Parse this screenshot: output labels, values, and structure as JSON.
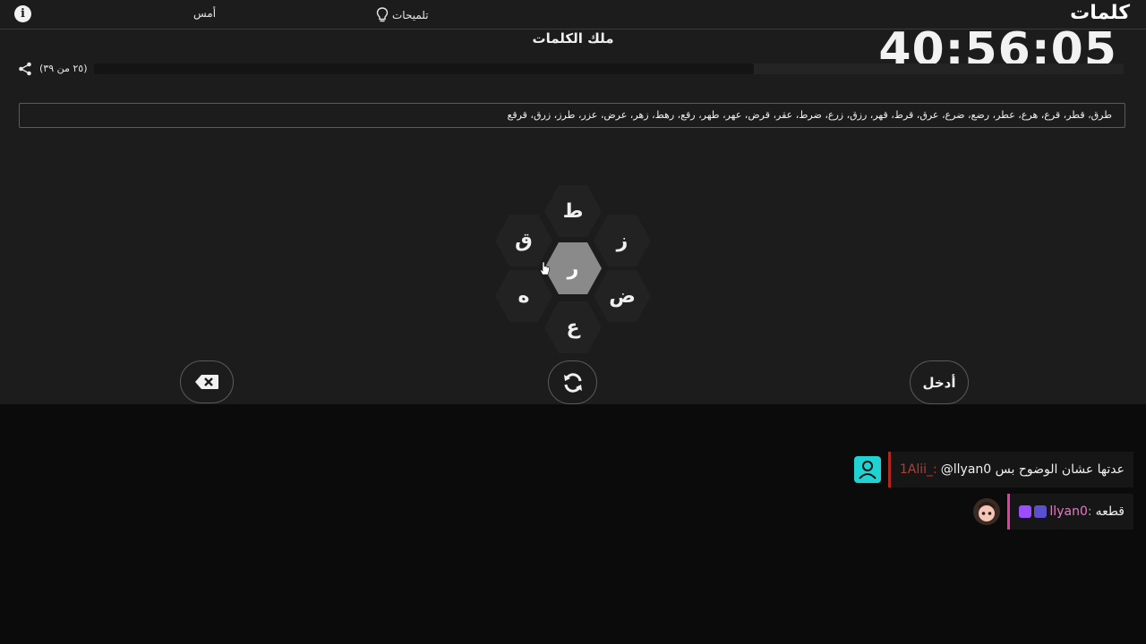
{
  "header": {
    "logo": "كلمات",
    "hints_label": "تلميحات",
    "yesterday_label": "أمس",
    "info_label": "i"
  },
  "timer": "40:56:05",
  "puzzle_title": "ملك الكلمات",
  "progress": {
    "text": "(٢٥ من ٣٩)",
    "found": 25,
    "total": 39
  },
  "found_words": "طرق، قطر، قرع، هرع، عطر، رضع، ضرع، عرق، قرط، قهر، رزق، زرع، ضرط، عقر، قرض، عهر، طهر، رقع، رهط، زهر، عرض، عزر، طرز، زرق، قرقع",
  "letters": {
    "center": "ر",
    "top": "ط",
    "top_right": "ز",
    "bottom_right": "ض",
    "bottom": "ع",
    "bottom_left": "ه",
    "top_left": "ق"
  },
  "controls": {
    "enter_label": "أدخل",
    "delete_icon": "backspace-icon",
    "shuffle_icon": "shuffle-icon"
  },
  "chat": [
    {
      "username": "1Alii_:",
      "text": "@llyan0 عدتها عشان الوضوح بس",
      "user_color": "#c0392b",
      "bar_color": "#b3261e",
      "avatar_color": "#1fd3d3",
      "avatar_icon": "user-icon"
    },
    {
      "username": "llyan0:",
      "text": "قطعه",
      "user_color": "#e879c9",
      "bar_color": "#e040a0",
      "avatar_color": "#f4c6b8",
      "avatar_icon": "girl-avatar-icon"
    }
  ],
  "colors": {
    "game_bg": "#1c1c1c",
    "page_bg": "#0b0b0b",
    "hex_bg": "#222222",
    "hex_center": "#8a8a8a"
  }
}
